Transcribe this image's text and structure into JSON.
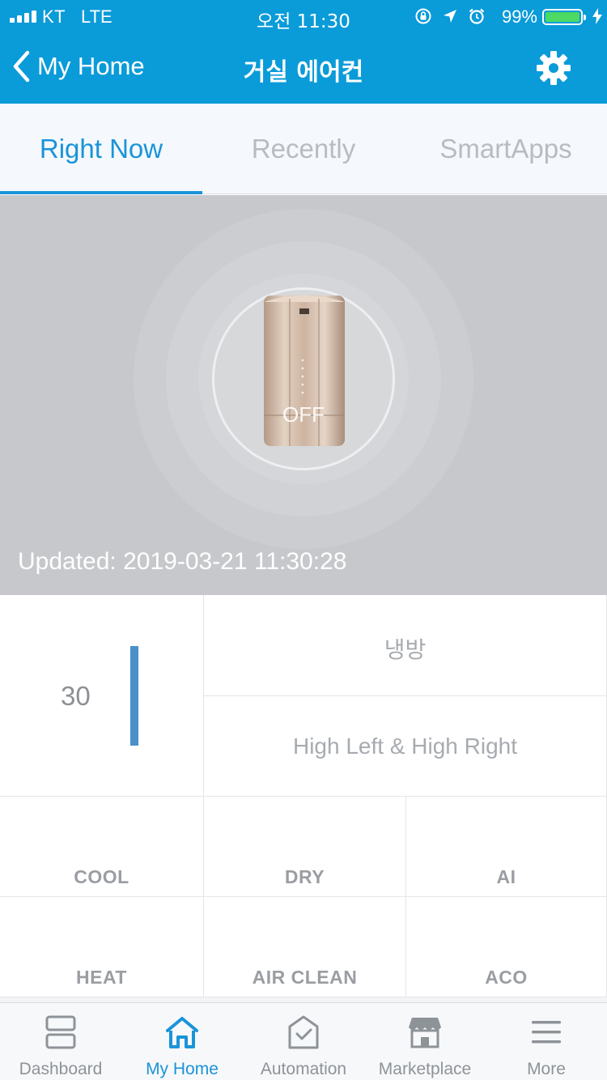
{
  "status_bar": {
    "carrier": "KT",
    "network": "LTE",
    "time": "오전 11:30",
    "battery_percent": "99%",
    "battery_level": 0.99,
    "icons": [
      "rotation-lock-icon",
      "location-arrow-icon",
      "alarm-icon",
      "charging-bolt-icon"
    ]
  },
  "nav": {
    "back_label": "My Home",
    "title": "거실 에어컨",
    "settings_icon": "gear-icon"
  },
  "tabs": [
    {
      "label": "Right Now",
      "active": true
    },
    {
      "label": "Recently",
      "active": false
    },
    {
      "label": "SmartApps",
      "active": false
    }
  ],
  "hero": {
    "power_state": "OFF",
    "updated": "Updated: 2019-03-21 11:30:28"
  },
  "controls": {
    "temperature": "30",
    "mode": "냉방",
    "wind": "High Left & High Right",
    "buttons": [
      "COOL",
      "DRY",
      "AI",
      "HEAT",
      "AIR CLEAN",
      "ACO"
    ]
  },
  "colors": {
    "brand": "#0a9bd9",
    "accent": "#1a94d8",
    "temp_bar": "#4a90c9"
  },
  "bottom_nav": [
    {
      "label": "Dashboard",
      "icon": "dashboard-icon",
      "active": false
    },
    {
      "label": "My Home",
      "icon": "home-icon",
      "active": true
    },
    {
      "label": "Automation",
      "icon": "automation-icon",
      "active": false
    },
    {
      "label": "Marketplace",
      "icon": "marketplace-icon",
      "active": false
    },
    {
      "label": "More",
      "icon": "menu-icon",
      "active": false
    }
  ]
}
